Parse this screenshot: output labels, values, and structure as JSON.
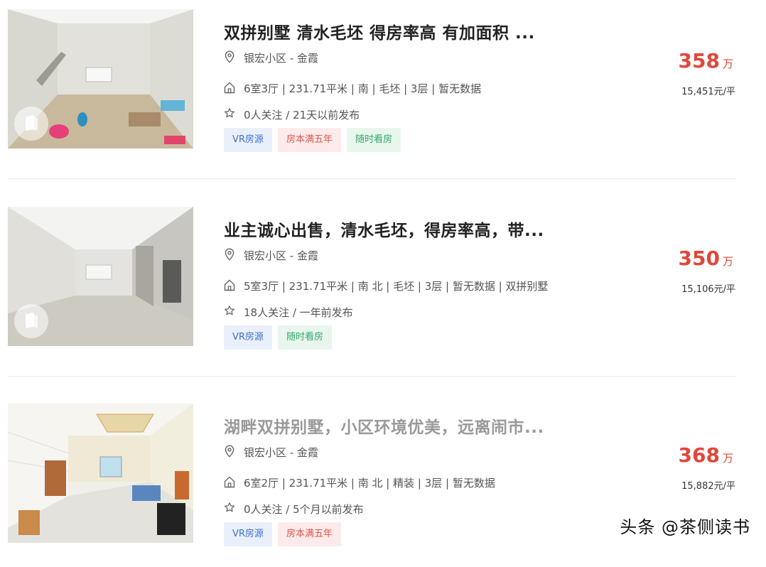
{
  "listings": [
    {
      "title": "双拼别墅 清水毛坯 得房率高 有加面积 ...",
      "community": "银宏小区 - 金霞",
      "house_info": "6室3厅 | 231.71平米 | 南 | 毛坯 | 3层 | 暂无数据",
      "follow_info": "0人关注 / 21天以前发布",
      "tags": {
        "vr": "VR房源",
        "years": "房本满五年",
        "anytime": "随时看房"
      },
      "total_price": "358",
      "price_unit": "万",
      "unit_price": "15,451元/平"
    },
    {
      "title": "业主诚心出售，清水毛坯，得房率高，带...",
      "community": "银宏小区 - 金霞",
      "house_info": "5室3厅 | 231.71平米 | 南 北 | 毛坯 | 3层 | 暂无数据 | 双拼别墅",
      "follow_info": "18人关注 / 一年前发布",
      "tags": {
        "vr": "VR房源",
        "anytime": "随时看房"
      },
      "total_price": "350",
      "price_unit": "万",
      "unit_price": "15,106元/平"
    },
    {
      "title": "湖畔双拼别墅，小区环境优美，远离闹市...",
      "community": "银宏小区 - 金霞",
      "house_info": "6室2厅 | 231.71平米 | 南 北 | 精装 | 3层 | 暂无数据",
      "follow_info": "0人关注 / 5个月以前发布",
      "tags": {
        "vr": "VR房源",
        "years": "房本满五年"
      },
      "total_price": "368",
      "price_unit": "万",
      "unit_price": "15,882元/平"
    }
  ],
  "watermark": "头条 @茶侧读书",
  "colors": {
    "price": "#e0473a",
    "title": "#222222",
    "visited_title": "#9a9a9a"
  }
}
